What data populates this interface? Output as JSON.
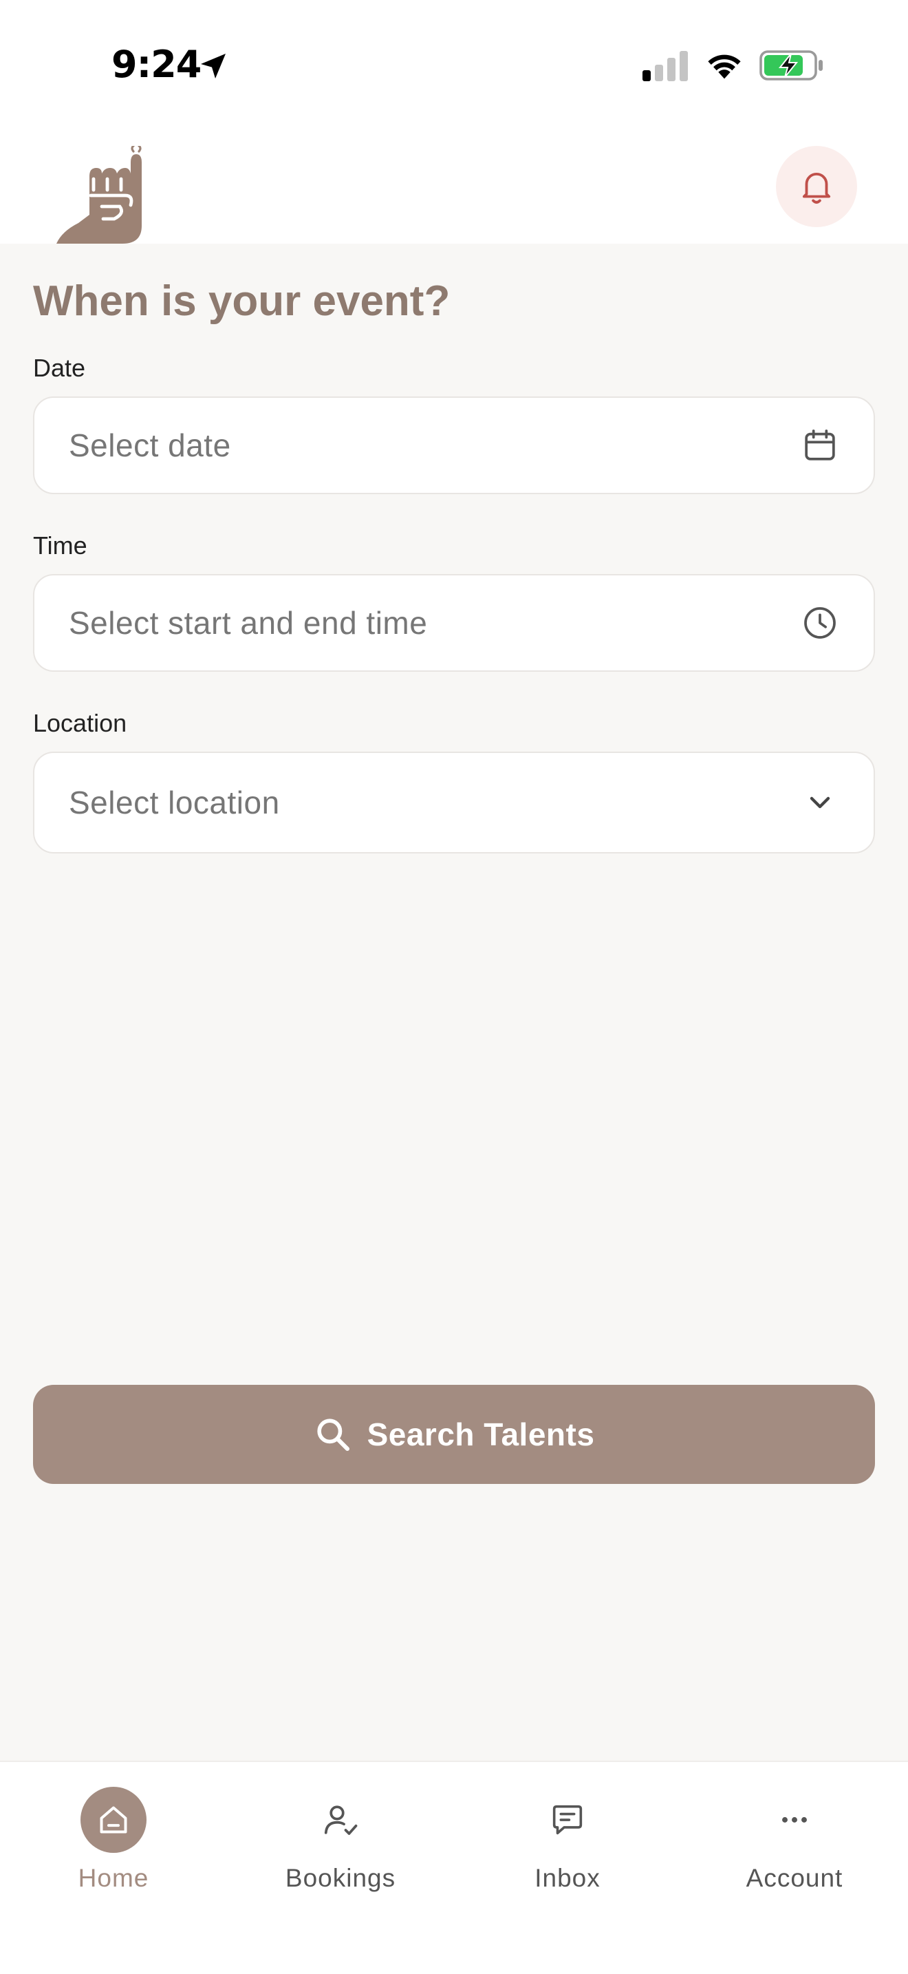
{
  "status_bar": {
    "time": "9:24",
    "icons": [
      "location-arrow-icon",
      "cellular-signal-icon",
      "wifi-icon",
      "battery-charging-icon"
    ]
  },
  "header": {
    "logo_icon": "pinky-promise-hand-logo",
    "notification_icon": "bell-icon"
  },
  "form": {
    "question": "When is your event?",
    "date": {
      "label": "Date",
      "placeholder": "Select date",
      "icon": "calendar-icon"
    },
    "time": {
      "label": "Time",
      "placeholder": "Select start and end time",
      "icon": "clock-icon"
    },
    "location": {
      "label": "Location",
      "placeholder": "Select location",
      "icon": "chevron-down-icon"
    }
  },
  "search_button": {
    "label": "Search Talents",
    "icon": "search-icon"
  },
  "tabbar": {
    "active": "Home",
    "tabs": [
      {
        "label": "Home",
        "icon": "home-icon"
      },
      {
        "label": "Bookings",
        "icon": "user-check-icon"
      },
      {
        "label": "Inbox",
        "icon": "message-icon"
      },
      {
        "label": "Account",
        "icon": "more-dots-icon"
      }
    ]
  },
  "colors": {
    "brand": "#a38c81",
    "heading": "#8e7a6f",
    "background": "#f8f7f5",
    "bell_bg": "#fbeeec",
    "bell": "#c0504a"
  }
}
